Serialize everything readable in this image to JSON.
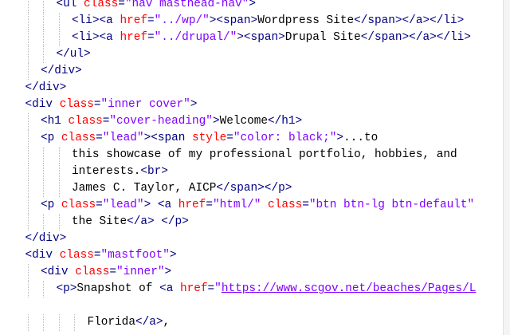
{
  "editor": {
    "lines": [
      {
        "indent": 3,
        "tokens": [
          [
            "tag",
            "<ul "
          ],
          [
            "attr",
            "class"
          ],
          [
            "tag",
            "="
          ],
          [
            "val",
            "\"nav masthead-nav\""
          ],
          [
            "tag",
            ">"
          ]
        ]
      },
      {
        "indent": 4,
        "tokens": [
          [
            "tag",
            "<li><a "
          ],
          [
            "attr",
            "href"
          ],
          [
            "tag",
            "="
          ],
          [
            "val",
            "\"../wp/\""
          ],
          [
            "tag",
            "><span>"
          ],
          [
            "txt",
            "Wordpress Site"
          ],
          [
            "tag",
            "</span></a></li>"
          ]
        ]
      },
      {
        "indent": 4,
        "tokens": [
          [
            "tag",
            "<li><a "
          ],
          [
            "attr",
            "href"
          ],
          [
            "tag",
            "="
          ],
          [
            "val",
            "\"../drupal/\""
          ],
          [
            "tag",
            "><span>"
          ],
          [
            "txt",
            "Drupal Site"
          ],
          [
            "tag",
            "</span></a></li>"
          ]
        ]
      },
      {
        "indent": 3,
        "tokens": [
          [
            "tag",
            "</ul>"
          ]
        ]
      },
      {
        "indent": 2,
        "tokens": [
          [
            "tag",
            "</div>"
          ]
        ]
      },
      {
        "indent": 1,
        "tokens": [
          [
            "tag",
            "</div>"
          ]
        ]
      },
      {
        "indent": 1,
        "tokens": [
          [
            "tag",
            "<div "
          ],
          [
            "attr",
            "class"
          ],
          [
            "tag",
            "="
          ],
          [
            "val",
            "\"inner cover\""
          ],
          [
            "tag",
            ">"
          ]
        ]
      },
      {
        "indent": 2,
        "tokens": [
          [
            "tag",
            "<h1 "
          ],
          [
            "attr",
            "class"
          ],
          [
            "tag",
            "="
          ],
          [
            "val",
            "\"cover-heading\""
          ],
          [
            "tag",
            ">"
          ],
          [
            "txt",
            "Welcome"
          ],
          [
            "tag",
            "</h1>"
          ]
        ]
      },
      {
        "indent": 2,
        "tokens": [
          [
            "tag",
            "<p "
          ],
          [
            "attr",
            "class"
          ],
          [
            "tag",
            "="
          ],
          [
            "val",
            "\"lead\""
          ],
          [
            "tag",
            "><span "
          ],
          [
            "attr",
            "style"
          ],
          [
            "tag",
            "="
          ],
          [
            "val",
            "\"color: black;\""
          ],
          [
            "tag",
            ">"
          ],
          [
            "txt",
            "...to"
          ]
        ]
      },
      {
        "indent": 4,
        "tokens": [
          [
            "txt",
            "this showcase of my professional portfolio, hobbies, and"
          ]
        ]
      },
      {
        "indent": 4,
        "tokens": [
          [
            "txt",
            "interests."
          ],
          [
            "tag",
            "<br>"
          ]
        ]
      },
      {
        "indent": 4,
        "tokens": [
          [
            "txt",
            "James C. Taylor, AICP"
          ],
          [
            "tag",
            "</span></p>"
          ]
        ]
      },
      {
        "indent": 2,
        "tokens": [
          [
            "tag",
            "<p "
          ],
          [
            "attr",
            "class"
          ],
          [
            "tag",
            "="
          ],
          [
            "val",
            "\"lead\""
          ],
          [
            "tag",
            "> <a "
          ],
          [
            "attr",
            "href"
          ],
          [
            "tag",
            "="
          ],
          [
            "val",
            "\"html/\""
          ],
          [
            "txt",
            " "
          ],
          [
            "attr",
            "class"
          ],
          [
            "tag",
            "="
          ],
          [
            "val",
            "\"btn btn-lg btn-default\""
          ]
        ]
      },
      {
        "indent": 4,
        "tokens": [
          [
            "txt",
            "the Site"
          ],
          [
            "tag",
            "</a> </p>"
          ]
        ]
      },
      {
        "indent": 1,
        "tokens": [
          [
            "tag",
            "</div>"
          ]
        ]
      },
      {
        "indent": 1,
        "tokens": [
          [
            "tag",
            "<div "
          ],
          [
            "attr",
            "class"
          ],
          [
            "tag",
            "="
          ],
          [
            "val",
            "\"mastfoot\""
          ],
          [
            "tag",
            ">"
          ]
        ]
      },
      {
        "indent": 2,
        "tokens": [
          [
            "tag",
            "<div "
          ],
          [
            "attr",
            "class"
          ],
          [
            "tag",
            "="
          ],
          [
            "val",
            "\"inner\""
          ],
          [
            "tag",
            ">"
          ]
        ]
      },
      {
        "indent": 3,
        "tokens": [
          [
            "tag",
            "<p>"
          ],
          [
            "txt",
            "Snapshot of "
          ],
          [
            "tag",
            "<a "
          ],
          [
            "attr",
            "href"
          ],
          [
            "tag",
            "="
          ],
          [
            "val",
            "\""
          ],
          [
            "url",
            "https://www.scgov.net/beaches/Pages/L"
          ]
        ]
      },
      {
        "indent": 0,
        "tokens": []
      },
      {
        "indent": 5,
        "tokens": [
          [
            "txt",
            "Florida"
          ],
          [
            "tag",
            "</a>"
          ],
          [
            "txt",
            ","
          ]
        ]
      }
    ]
  },
  "colors": {
    "tag": "#000080",
    "attribute": "#ff0000",
    "value": "#8000ff",
    "text": "#000000",
    "background": "#ffffff"
  }
}
